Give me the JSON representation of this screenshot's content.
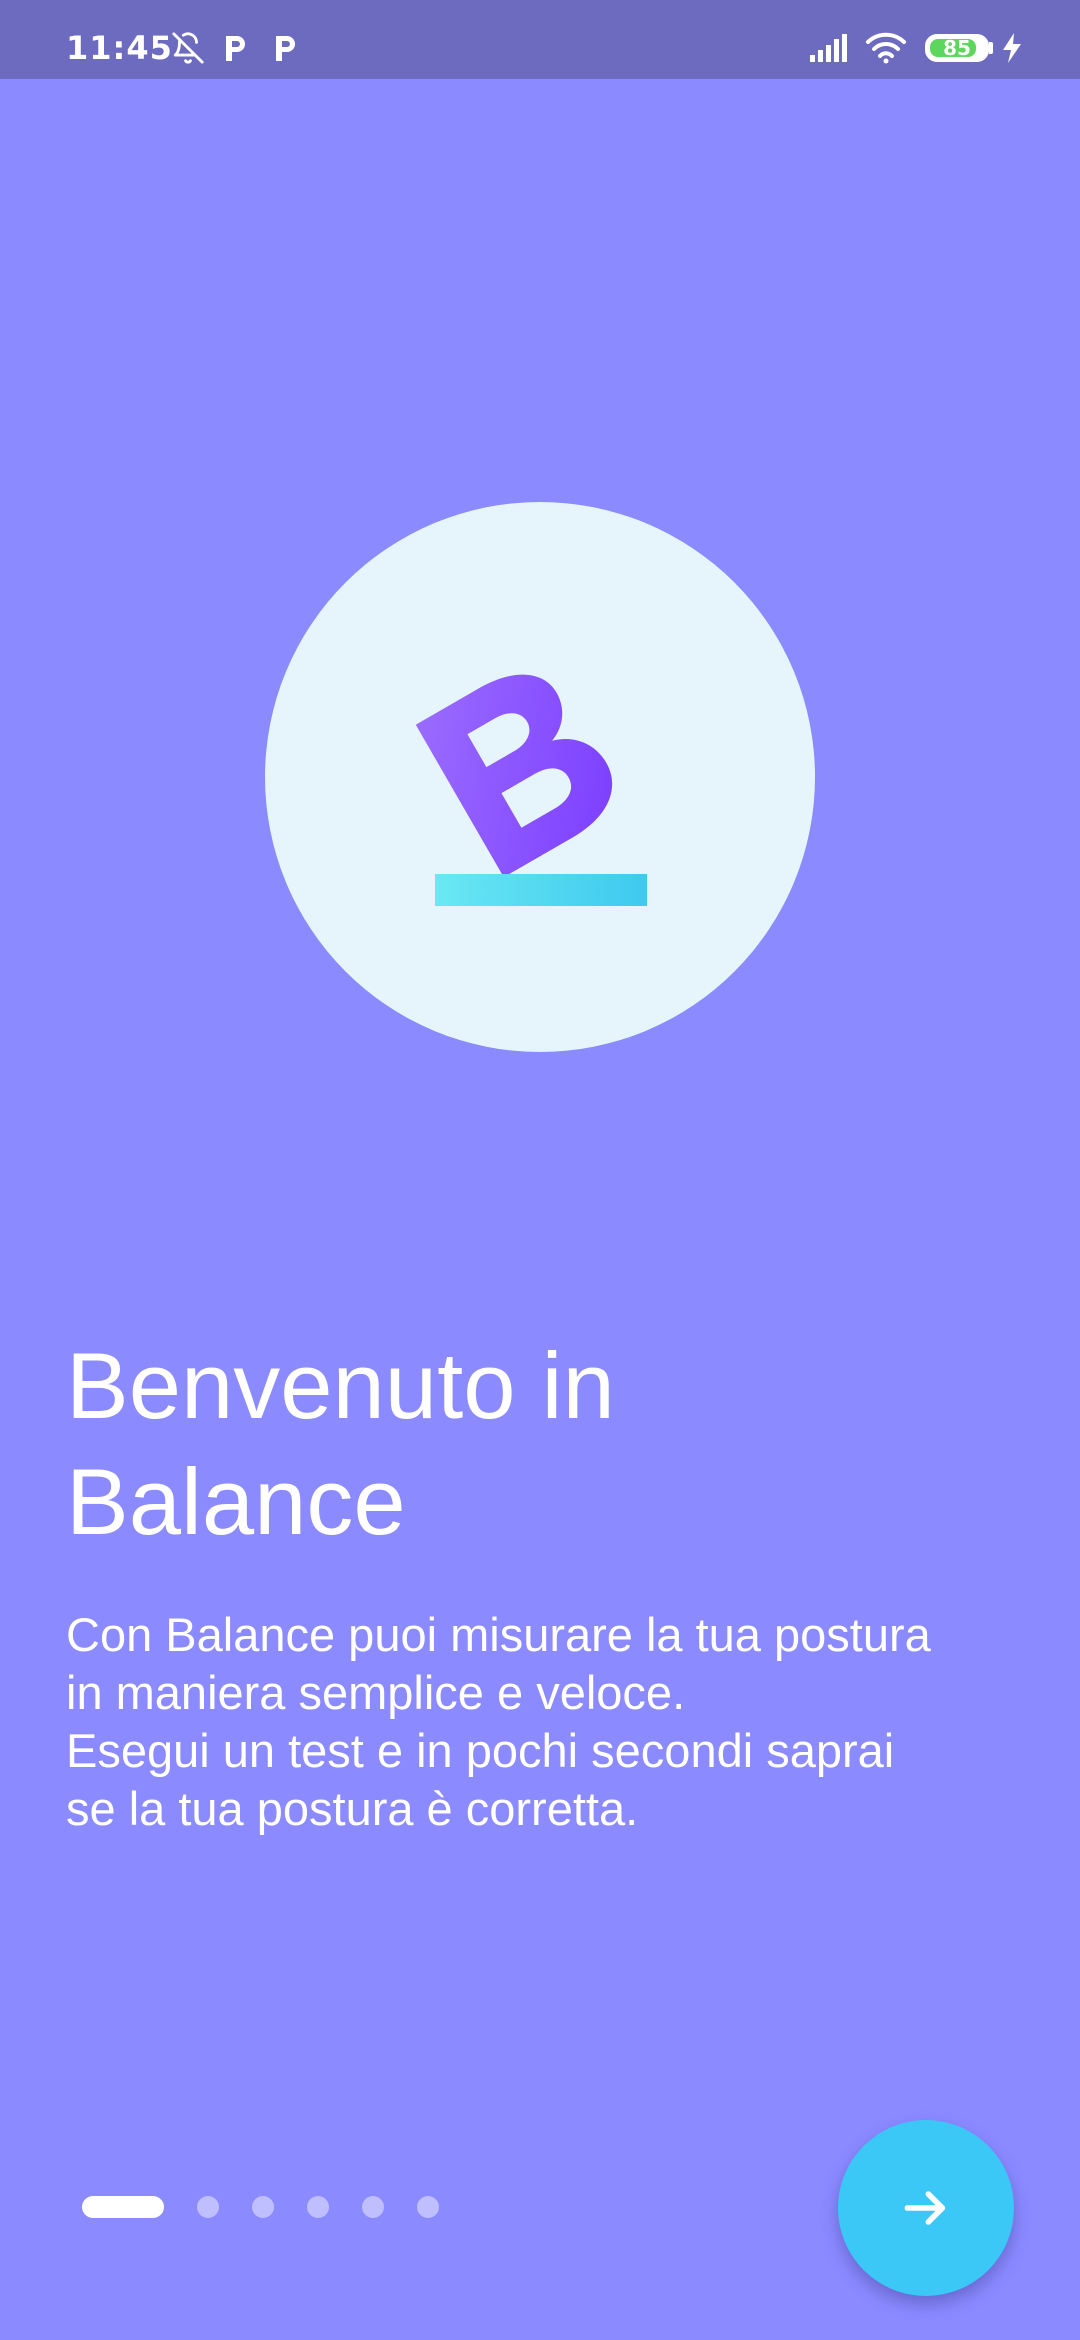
{
  "status_bar": {
    "time": "11:45",
    "battery_level": "85",
    "battery_fraction": 0.85,
    "icons": [
      "bell-off-icon",
      "parking-app-icon",
      "parking-app-icon",
      "signal-icon",
      "wifi-icon",
      "battery-icon",
      "charging-bolt-icon"
    ]
  },
  "logo": {
    "icon": "balance-b-logo-icon",
    "letter_color": "#8a4dff",
    "bar_color": "#48d6f0",
    "circle_color": "#e6f5fb"
  },
  "welcome": {
    "title": "Benvenuto in\nBalance",
    "description": "Con Balance puoi misurare la tua postura\nin maniera semplice e veloce.\nEsegui un test e in pochi secondi saprai\nse la tua postura è corretta."
  },
  "pager": {
    "total_pages": 6,
    "current_page": 1
  },
  "next_button": {
    "icon": "arrow-right-icon",
    "color": "#3cc8f6"
  },
  "colors": {
    "background": "#8b8aff",
    "status_bar": "#6c6bc0",
    "text": "#ffffff"
  }
}
